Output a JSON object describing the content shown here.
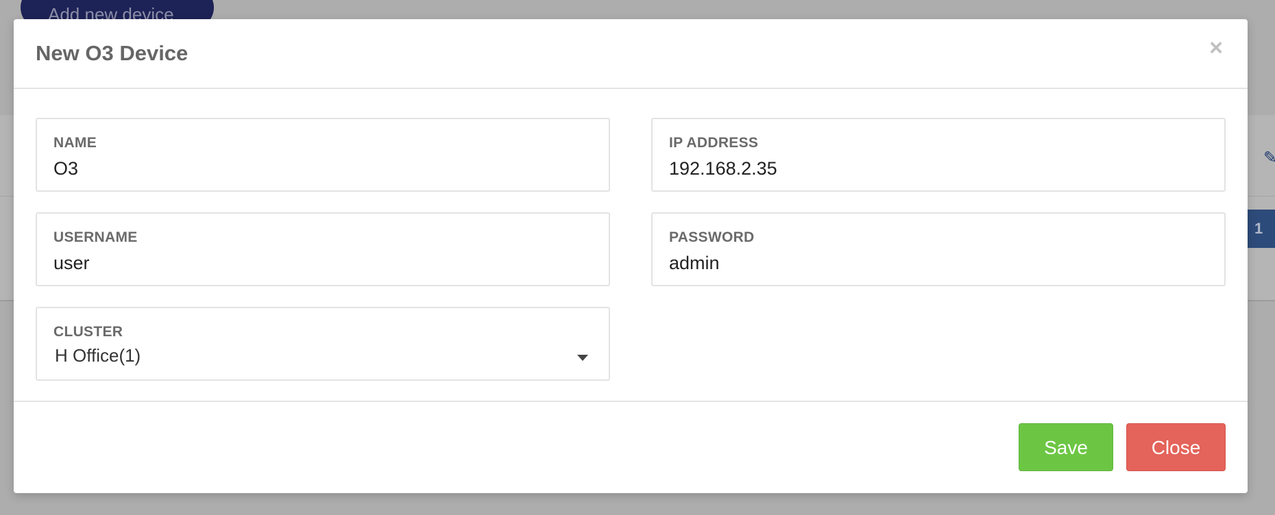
{
  "background": {
    "add_device_button": "Add new device",
    "pagination_current": "1",
    "edit_icon": "pencil-icon"
  },
  "modal": {
    "title": "New O3 Device",
    "close_icon": "close-icon",
    "fields": {
      "name": {
        "label": "NAME",
        "value": "O3"
      },
      "ip_address": {
        "label": "IP ADDRESS",
        "value": "192.168.2.35"
      },
      "username": {
        "label": "USERNAME",
        "value": "user"
      },
      "password": {
        "label": "PASSWORD",
        "value": "admin"
      },
      "cluster": {
        "label": "CLUSTER",
        "selected": "H Office(1)"
      }
    },
    "buttons": {
      "save": "Save",
      "close": "Close"
    }
  },
  "colors": {
    "save": "#6cc644",
    "close": "#e4635a",
    "overlay": "#adadad",
    "primary_dark": "#1d2257"
  }
}
